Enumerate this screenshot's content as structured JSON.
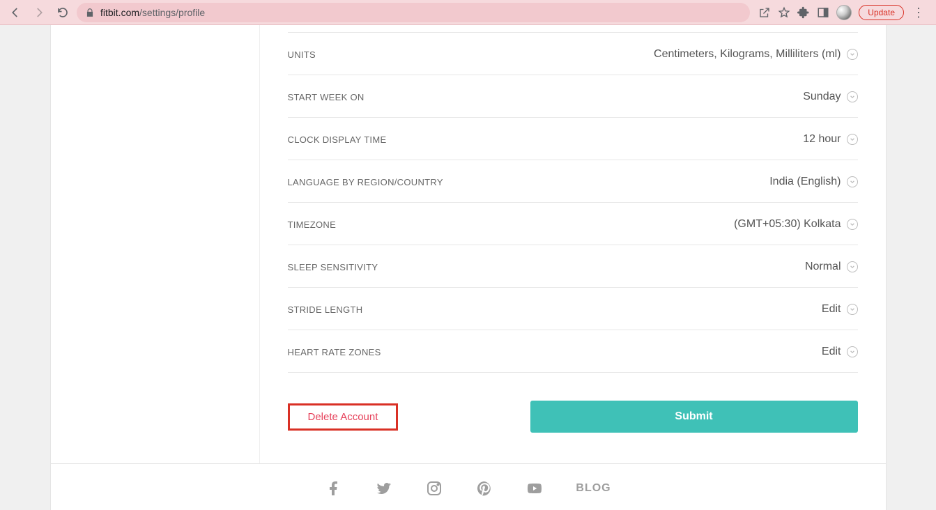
{
  "browser": {
    "url_host": "fitbit.com",
    "url_path": "/settings/profile",
    "update_label": "Update"
  },
  "settings": [
    {
      "label": "UNITS",
      "value": "Centimeters, Kilograms, Milliliters (ml)"
    },
    {
      "label": "START WEEK ON",
      "value": "Sunday"
    },
    {
      "label": "CLOCK DISPLAY TIME",
      "value": "12 hour"
    },
    {
      "label": "LANGUAGE BY REGION/COUNTRY",
      "value": "India (English)"
    },
    {
      "label": "TIMEZONE",
      "value": "(GMT+05:30) Kolkata"
    },
    {
      "label": "SLEEP SENSITIVITY",
      "value": "Normal"
    },
    {
      "label": "STRIDE LENGTH",
      "value": "Edit"
    },
    {
      "label": "HEART RATE ZONES",
      "value": "Edit"
    }
  ],
  "actions": {
    "delete_label": "Delete Account",
    "submit_label": "Submit"
  },
  "footer": {
    "blog_label": "BLOG"
  }
}
